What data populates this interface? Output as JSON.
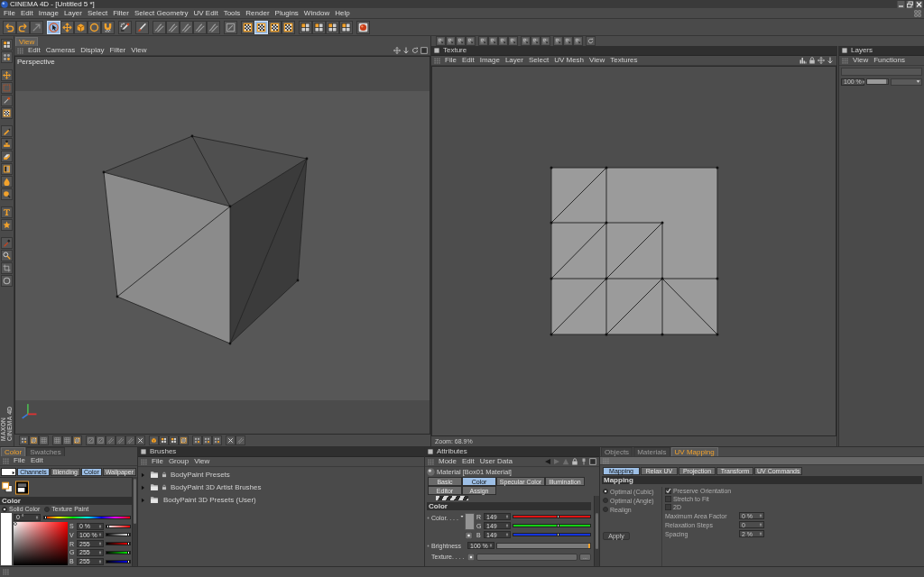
{
  "window": {
    "title": "CINEMA 4D - [Untitled 5 *]"
  },
  "menu": [
    "File",
    "Edit",
    "Image",
    "Layer",
    "Select",
    "Filter",
    "Select Geometry",
    "UV Edit",
    "Tools",
    "Render",
    "Plugins",
    "Window",
    "Help"
  ],
  "toolbar": [
    {
      "selected": false
    },
    {
      "selected": false
    },
    {
      "selected": false
    },
    {
      "selected": true
    },
    {
      "selected": false
    },
    {
      "selected": false
    },
    {
      "selected": false
    },
    {
      "selected": false
    },
    {
      "selected": false
    },
    {
      "selected": false
    },
    {
      "selected": false
    },
    {
      "selected": false
    },
    {
      "selected": false
    },
    {
      "selected": false
    },
    {
      "selected": false
    },
    {
      "selected": false
    },
    {
      "selected": false
    },
    {
      "selected": true
    },
    {
      "selected": false
    },
    {
      "selected": false
    },
    {
      "selected": false
    },
    {
      "selected": false
    },
    {
      "selected": false
    },
    {
      "selected": false
    },
    {
      "selected": false
    }
  ],
  "logo": [
    "MAXON",
    "CINEMA 4D"
  ],
  "view_panel": {
    "tab": "View",
    "menu": [
      "Edit",
      "Cameras",
      "Display",
      "Filter",
      "View"
    ],
    "camera": "Perspective"
  },
  "texture_panel": {
    "title": "Texture",
    "menu": [
      "File",
      "Edit",
      "Image",
      "Layer",
      "Select",
      "UV Mesh",
      "View",
      "Textures"
    ],
    "zoom": "Zoom: 68.9%"
  },
  "layers_panel": {
    "title": "Layers",
    "menu": [
      "View",
      "Functions"
    ],
    "opacity": {
      "value": "100 %",
      "level": 1
    }
  },
  "color_panel": {
    "tabs": [
      {
        "label": "Color",
        "selected": true
      },
      {
        "label": "Swatches",
        "selected": false
      }
    ],
    "menu": [
      "File",
      "Edit"
    ],
    "modes": [
      {
        "label": "Channels",
        "selected": true
      },
      {
        "label": "Blending",
        "selected": false
      },
      {
        "label": "Color",
        "selected": true
      },
      {
        "label": "Wallpaper",
        "selected": false
      }
    ],
    "section": "Color",
    "paint_modes": [
      {
        "label": "Solid Color",
        "selected": true
      },
      {
        "label": "Texture Paint",
        "selected": false
      }
    ],
    "hue": {
      "value": "0 °",
      "level": 0
    },
    "channels": [
      {
        "label": "S",
        "value": "0 %",
        "level": 0
      },
      {
        "label": "V",
        "value": "100 %",
        "level": 1
      },
      {
        "label": "R",
        "value": "255",
        "level": 1
      },
      {
        "label": "G",
        "value": "255",
        "level": 1
      },
      {
        "label": "B",
        "value": "255",
        "level": 1
      }
    ]
  },
  "brushes_panel": {
    "title": "Brushes",
    "menu": [
      "File",
      "Group",
      "View"
    ],
    "tree": [
      {
        "label": "BodyPaint Presets",
        "expanded": false,
        "locked": true
      },
      {
        "label": "BodyPaint 3D Artist Brushes",
        "expanded": false,
        "locked": true
      },
      {
        "label": "BodyPaint 3D Presets (User)",
        "expanded": false,
        "locked": false
      }
    ]
  },
  "attributes_panel": {
    "title": "Attributes",
    "menu": [
      "Mode",
      "Edit",
      "User Data"
    ],
    "material": "Material [Box01 Material]",
    "tabs": [
      {
        "label": "Basic",
        "selected": false
      },
      {
        "label": "Color",
        "selected": true
      },
      {
        "label": "Specular Color",
        "selected": false
      },
      {
        "label": "Illumination",
        "selected": false
      },
      {
        "label": "Editor",
        "selected": false
      },
      {
        "label": "Assign",
        "selected": false
      }
    ],
    "section": "Color",
    "color": {
      "label": "Color. . . .",
      "channels": [
        {
          "label": "R",
          "value": "149",
          "level": 0.58
        },
        {
          "label": "G",
          "value": "149",
          "level": 0.58
        },
        {
          "label": "B",
          "value": "149",
          "level": 0.58
        }
      ]
    },
    "brightness": {
      "label": "Brightness",
      "value": "100 %",
      "level": 1
    },
    "texture": {
      "label": "Texture. . . .",
      "button": "..."
    }
  },
  "uv_panel": {
    "tabs": [
      {
        "label": "Objects",
        "selected": false
      },
      {
        "label": "Materials",
        "selected": false
      },
      {
        "label": "UV Mapping",
        "selected": true
      }
    ],
    "subtabs": [
      {
        "label": "Mapping",
        "selected": true
      },
      {
        "label": "Relax UV",
        "selected": false
      },
      {
        "label": "Projection",
        "selected": false
      },
      {
        "label": "Transform",
        "selected": false
      },
      {
        "label": "UV Commands",
        "selected": false
      }
    ],
    "section": "Mapping",
    "disabled": true,
    "methods": [
      {
        "label": "Optimal (Cubic)",
        "selected": true
      },
      {
        "label": "Optimal (Angle)",
        "selected": false
      },
      {
        "label": "Realign",
        "selected": false
      }
    ],
    "options": [
      {
        "label": "Preserve Orientation",
        "checked": true
      },
      {
        "label": "Stretch to Fit",
        "checked": false
      },
      {
        "label": "2D",
        "checked": false
      }
    ],
    "fields": [
      {
        "label": "Maximum Area Factor",
        "value": "0 %"
      },
      {
        "label": "Relaxation Steps",
        "value": "0"
      },
      {
        "label": "Spacing",
        "value": "2 %"
      }
    ],
    "apply": "Apply"
  }
}
